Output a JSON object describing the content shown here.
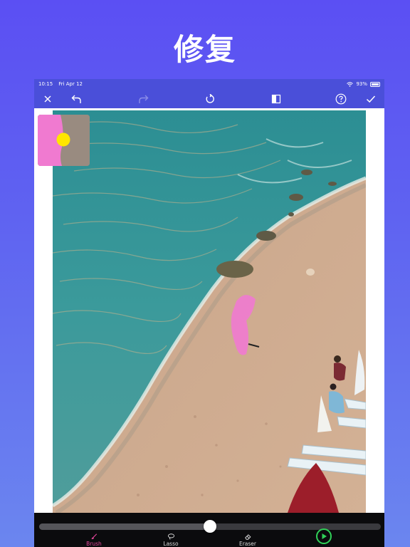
{
  "headline": "修复",
  "status_bar": {
    "time": "10:15",
    "date": "Fri Apr 12",
    "battery": "93%"
  },
  "toolbar": {
    "icons": [
      "close-icon",
      "undo-icon",
      "redo-icon",
      "reset-icon",
      "compare-icon",
      "help-icon",
      "confirm-icon"
    ]
  },
  "tools": [
    {
      "label": "Brush",
      "icon": "brush-icon",
      "active": true
    },
    {
      "label": "Lasso",
      "icon": "lasso-icon",
      "active": false
    },
    {
      "label": "Eraser",
      "icon": "eraser-icon",
      "active": false
    }
  ],
  "brush_size": 0.5,
  "colors": {
    "header": "#4a4fd9",
    "accent_pink": "#e4469a",
    "mask_pink": "#f07ad0",
    "play_green": "#30d158",
    "magnifier_cursor": "#ffe600"
  }
}
